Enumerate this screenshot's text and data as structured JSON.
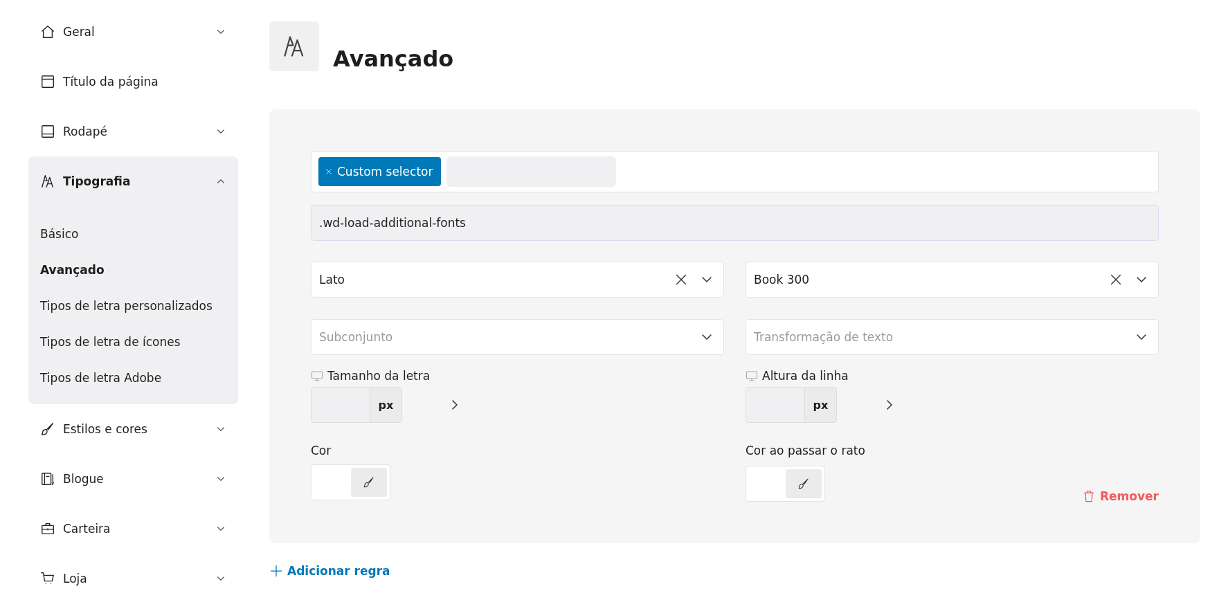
{
  "sidebar": {
    "items": [
      {
        "label": "Geral",
        "kind": "group",
        "expanded": false
      },
      {
        "label": "Título da página",
        "kind": "link"
      },
      {
        "label": "Rodapé",
        "kind": "group",
        "expanded": false
      },
      {
        "label": "Tipografia",
        "kind": "group",
        "expanded": true,
        "children": [
          {
            "label": "Básico",
            "selected": false
          },
          {
            "label": "Avançado",
            "selected": true
          },
          {
            "label": "Tipos de letra personalizados",
            "selected": false
          },
          {
            "label": "Tipos de letra de ícones",
            "selected": false
          },
          {
            "label": "Tipos de letra Adobe",
            "selected": false
          }
        ]
      },
      {
        "label": "Estilos e cores",
        "kind": "group",
        "expanded": false
      },
      {
        "label": "Blogue",
        "kind": "group",
        "expanded": false
      },
      {
        "label": "Carteira",
        "kind": "group",
        "expanded": false
      },
      {
        "label": "Loja",
        "kind": "group",
        "expanded": false
      }
    ]
  },
  "page": {
    "title": "Avançado"
  },
  "rule": {
    "tags": [
      "Custom selector"
    ],
    "selector": ".wd-load-additional-fonts",
    "selects": [
      {
        "value": "Lato",
        "clearable": true
      },
      {
        "value": "Book 300",
        "clearable": true
      },
      {
        "placeholder": "Subconjunto",
        "clearable": false
      },
      {
        "placeholder": "Transformação de texto",
        "clearable": false
      }
    ],
    "sizes": [
      {
        "label": "Tamanho da letra",
        "unit": "px"
      },
      {
        "label": "Altura da linha",
        "unit": "px"
      }
    ],
    "colors": [
      {
        "label": "Cor"
      },
      {
        "label": "Cor ao passar o rato"
      }
    ],
    "remove": "Remover"
  },
  "add_rule": "Adicionar regra"
}
